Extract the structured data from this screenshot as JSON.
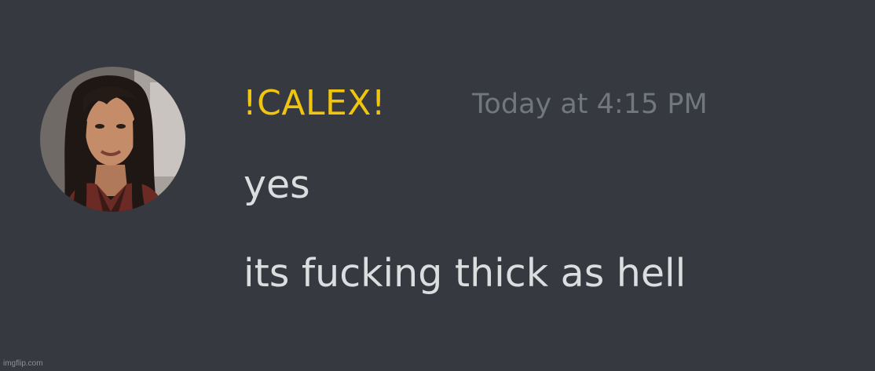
{
  "message": {
    "username": "!CALEX!",
    "timestamp": "Today at 4:15 PM",
    "lines": [
      "yes",
      "its fucking thick as hell"
    ]
  },
  "watermark": "imgflip.com",
  "colors": {
    "background": "#36393f",
    "username": "#f1c40f",
    "timestamp": "#72767d",
    "message_text": "#dcddde"
  },
  "icons": {
    "avatar": "user-avatar-photo"
  }
}
